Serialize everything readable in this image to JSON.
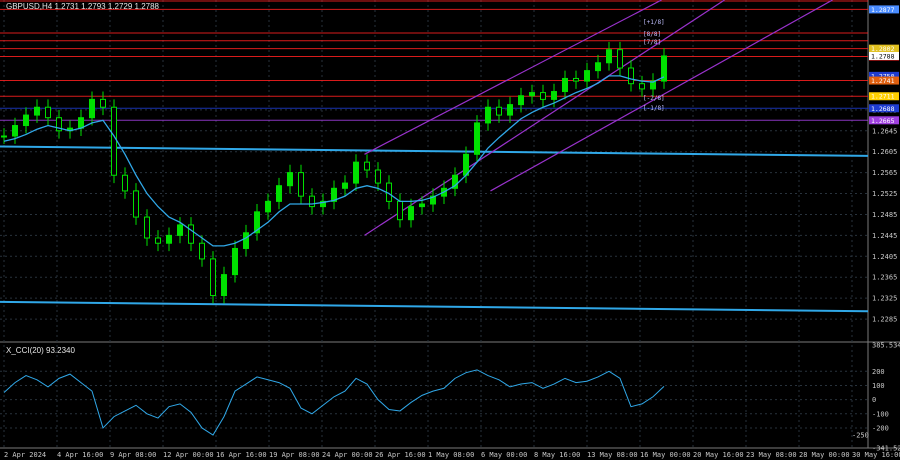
{
  "chart_data": [
    {
      "type": "candlestick",
      "title": "GBPUSD,H4  1.2731 1.2793 1.2729 1.2788",
      "symbol": "GBPUSD",
      "timeframe": "H4",
      "ohlc_last": {
        "open": 1.2731,
        "high": 1.2793,
        "low": 1.2729,
        "close": 1.2788
      },
      "ylim": [
        1.2245,
        1.2895
      ],
      "y_ticks": [
        1.2285,
        1.2325,
        1.2365,
        1.2405,
        1.2445,
        1.2485,
        1.2525,
        1.2565,
        1.2605,
        1.2645,
        1.2685
      ],
      "y_tick_labels": [
        "1.2285",
        "1.2325",
        "1.2365",
        "1.2405",
        "1.2445",
        "1.2485",
        "1.2525",
        "1.2565",
        "1.2605",
        "1.2645",
        "1.2685"
      ],
      "x_labels": [
        "2 Apr 2024",
        "4 Apr 16:00",
        "9 Apr 08:00",
        "12 Apr 00:00",
        "16 Apr 16:00",
        "19 Apr 08:00",
        "24 Apr 00:00",
        "26 Apr 16:00",
        "1 May 08:00",
        "6 May 00:00",
        "8 May 16:00",
        "13 May 08:00",
        "16 May 00:00",
        "20 May 16:00",
        "23 May 08:00",
        "28 May 00:00",
        "30 May 16:00"
      ],
      "close_series": [
        1.2635,
        1.2655,
        1.2675,
        1.269,
        1.267,
        1.2645,
        1.265,
        1.267,
        1.2705,
        1.269,
        1.256,
        1.253,
        1.248,
        1.244,
        1.243,
        1.2445,
        1.2465,
        1.243,
        1.24,
        1.233,
        1.237,
        1.242,
        1.245,
        1.249,
        1.251,
        1.254,
        1.2565,
        1.252,
        1.25,
        1.251,
        1.2535,
        1.2545,
        1.2585,
        1.257,
        1.2545,
        1.251,
        1.2475,
        1.25,
        1.2505,
        1.252,
        1.2535,
        1.256,
        1.26,
        1.266,
        1.269,
        1.2675,
        1.2695,
        1.2712,
        1.2718,
        1.2705,
        1.272,
        1.2745,
        1.274,
        1.276,
        1.2775,
        1.28,
        1.2765,
        1.2735,
        1.2725,
        1.274,
        1.2788
      ],
      "moving_average": [
        1.2625,
        1.263,
        1.2638,
        1.2648,
        1.2655,
        1.265,
        1.2645,
        1.265,
        1.266,
        1.2665,
        1.2635,
        1.26,
        1.256,
        1.2525,
        1.25,
        1.248,
        1.247,
        1.2455,
        1.244,
        1.2425,
        1.2425,
        1.243,
        1.244,
        1.2455,
        1.247,
        1.249,
        1.2505,
        1.2505,
        1.2505,
        1.2508,
        1.2512,
        1.252,
        1.2535,
        1.254,
        1.2535,
        1.2525,
        1.251,
        1.251,
        1.2512,
        1.2518,
        1.2528,
        1.254,
        1.256,
        1.2585,
        1.2612,
        1.2632,
        1.265,
        1.2668,
        1.268,
        1.269,
        1.2698,
        1.2708,
        1.2718,
        1.2726,
        1.2736,
        1.275,
        1.275,
        1.2744,
        1.274,
        1.2738,
        1.2748
      ],
      "price_tags": [
        {
          "label": "1.2877",
          "value": 1.2877,
          "color": "#4a8cff"
        },
        {
          "label": "1.2802",
          "value": 1.2802,
          "color": "#e0c020"
        },
        {
          "label": "1.2787",
          "value": 1.2787,
          "color": "#ff2020"
        },
        {
          "label": "1.2750",
          "value": 1.275,
          "color": "#1e3cd0"
        },
        {
          "label": "1.2741",
          "value": 1.2741,
          "color": "#e06010"
        },
        {
          "label": "1.2711",
          "value": 1.2711,
          "color": "#ffd000"
        },
        {
          "label": "1.2688",
          "value": 1.2688,
          "color": "#1e3cd0"
        },
        {
          "label": "1.2665",
          "value": 1.2665,
          "color": "#a040e0"
        }
      ],
      "murray_labels": [
        "[+1/8]",
        "[8/8]",
        "[7/8]",
        "[-2/8]",
        "[-1/8]"
      ],
      "horizontal_levels": [
        1.2893,
        1.2877,
        1.2832,
        1.2817,
        1.2802,
        1.2787,
        1.2741,
        1.2711,
        1.2688,
        1.2665
      ],
      "trend_lines": [
        {
          "name": "senkou-span-upper",
          "color": "#30a8e8",
          "start": 1.2615,
          "end": 1.2597
        },
        {
          "name": "senkou-span-lower",
          "color": "#30a8e8",
          "start": 1.2318,
          "end": 1.23
        }
      ],
      "channel_lines": [
        {
          "color": "#9932cc",
          "x1": 0.405,
          "y1": 1.2445,
          "x2": 0.805,
          "y2": 1.2895
        },
        {
          "color": "#9932cc",
          "x1": 0.405,
          "y1": 1.26,
          "x2": 0.735,
          "y2": 1.2895
        },
        {
          "color": "#9932cc",
          "x1": 0.545,
          "y1": 1.253,
          "x2": 0.925,
          "y2": 1.2895
        }
      ],
      "colors": {
        "up_candle": "#00e000",
        "down_candle": "#00e000",
        "ma": "#30a8e8",
        "grid": "#28323c",
        "axis_text": "#c8c8c8"
      }
    },
    {
      "type": "line",
      "title": "X_CCI(20) 93.2340",
      "indicator": "CCI",
      "period": 20,
      "last_value": 93.234,
      "ylim": [
        -341.5217,
        385.5341
      ],
      "y_ticks": [
        385.5341,
        200,
        100,
        0,
        -100,
        -200,
        -341.5217
      ],
      "y_tick_labels": [
        "385.5341",
        "200",
        "100",
        "0",
        "-100",
        "-200",
        "-341.5217"
      ],
      "extra_ticks": [
        -250
      ],
      "values": [
        50,
        120,
        170,
        140,
        90,
        150,
        180,
        120,
        60,
        -200,
        -120,
        -80,
        -40,
        -100,
        -130,
        -50,
        -30,
        -90,
        -200,
        -250,
        -120,
        60,
        110,
        160,
        140,
        120,
        80,
        -60,
        -100,
        -40,
        20,
        60,
        150,
        110,
        0,
        -70,
        -80,
        -20,
        30,
        60,
        80,
        150,
        190,
        210,
        170,
        140,
        90,
        110,
        120,
        80,
        110,
        150,
        120,
        130,
        160,
        200,
        150,
        -50,
        -30,
        20,
        93.234
      ]
    }
  ]
}
